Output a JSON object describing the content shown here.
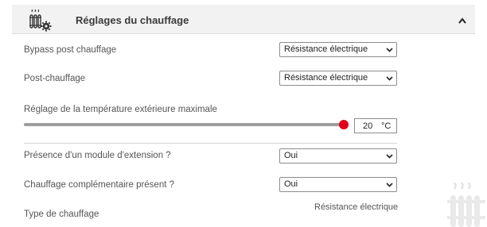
{
  "header": {
    "title": "Réglages du chauffage",
    "icon": "radiator-gear-icon",
    "collapse_icon": "chevron-up-icon"
  },
  "fields": {
    "bypass": {
      "label": "Bypass post chauffage",
      "value": "Résistance électrique"
    },
    "post_heating": {
      "label": "Post-chauffage",
      "value": "Résistance électrique"
    },
    "max_outdoor_temp": {
      "label": "Réglage de la température extérieure maximale",
      "value": "20",
      "unit": "°C",
      "slider_fraction": 1.0
    },
    "extension_module": {
      "label": "Présence d'un module d'extension ?",
      "value": "Oui"
    },
    "complementary_heating": {
      "label": "Chauffage complémentaire présent ?",
      "value": "Oui"
    },
    "heating_type": {
      "label": "Type de chauffage",
      "value": "Résistance électrique"
    }
  },
  "colors": {
    "accent": "#e0001b",
    "header_bg": "#f2f2f2",
    "slider_fill": "#9e9e9e"
  },
  "decoration": {
    "corner_icon": "radiator-watermark-icon"
  }
}
